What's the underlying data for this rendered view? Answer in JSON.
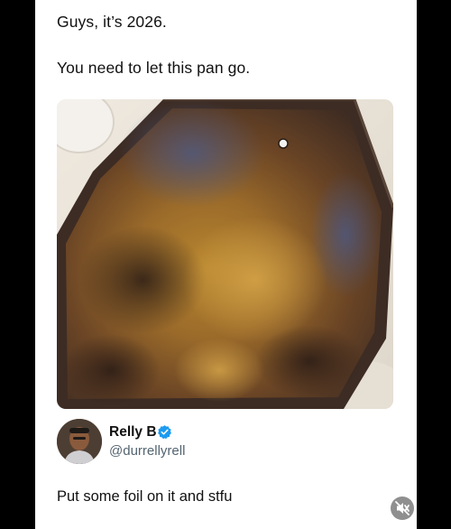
{
  "post": {
    "line1": "Guys, it’s 2026.",
    "line2": "You need to let this pan go.",
    "image": {
      "subject": "pan-photo"
    }
  },
  "quoted_author": {
    "name": "Relly B",
    "handle": "@durrellyrell",
    "verified": true,
    "verified_color": "#1d9bf0"
  },
  "reply_text": "Put some foil on it and stfu",
  "controls": {
    "mute_icon": "speaker-muted-icon"
  },
  "colors": {
    "background": "#000000",
    "card": "#ffffff",
    "text": "#111111",
    "handle": "#536471"
  }
}
